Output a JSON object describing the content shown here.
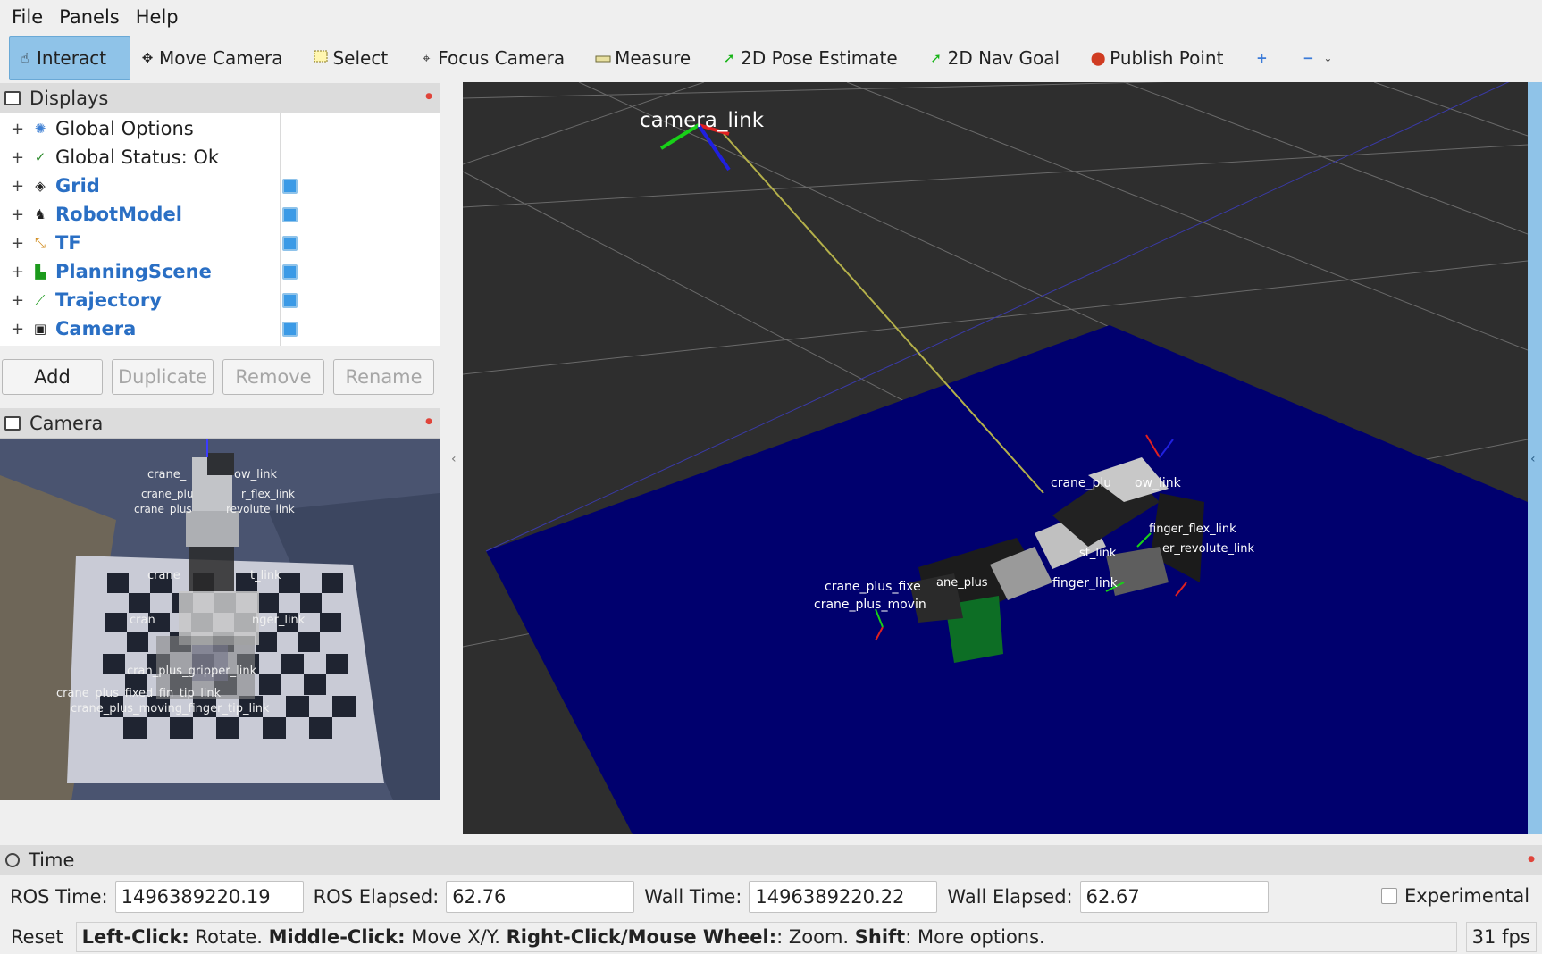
{
  "menu": {
    "file": "File",
    "panels": "Panels",
    "help": "Help"
  },
  "toolbar": {
    "interact": "Interact",
    "move_camera": "Move Camera",
    "select": "Select",
    "focus_camera": "Focus Camera",
    "measure": "Measure",
    "pose_estimate": "2D Pose Estimate",
    "nav_goal": "2D Nav Goal",
    "publish_point": "Publish Point"
  },
  "displays": {
    "title": "Displays",
    "items": [
      {
        "label": "Global Options",
        "icon": "gear-icon",
        "checked": false
      },
      {
        "label": "Global Status: Ok",
        "icon": "check-icon",
        "checked": false
      },
      {
        "label": "Grid",
        "icon": "grid-icon",
        "checked": true
      },
      {
        "label": "RobotModel",
        "icon": "robot-icon",
        "checked": true
      },
      {
        "label": "TF",
        "icon": "tf-axes-icon",
        "checked": true
      },
      {
        "label": "PlanningScene",
        "icon": "planning-scene-icon",
        "checked": true
      },
      {
        "label": "Trajectory",
        "icon": "trajectory-icon",
        "checked": true
      },
      {
        "label": "Camera",
        "icon": "camera-icon",
        "checked": true
      }
    ],
    "buttons": {
      "add": "Add",
      "duplicate": "Duplicate",
      "remove": "Remove",
      "rename": "Rename"
    }
  },
  "camera_panel": {
    "title": "Camera",
    "labels": {
      "l1": "crane_",
      "l1b": "ow_link",
      "l2": "crane_plu",
      "l2b": "r_flex_link",
      "l3": "crane_plus",
      "l3b": "revolute_link",
      "l4": "crane",
      "l4b": "t_link",
      "l5": "cran",
      "l5b": "nger_link",
      "l6": "cran_plus_gripper_link",
      "l7": "crane_plus_fixed_fin_tip_link",
      "l8": "crane_plus_moving_finger_tip_link"
    }
  },
  "view3d": {
    "frame_label": "camera_link",
    "labels": {
      "a": "crane_plu",
      "ab": "ow_link",
      "b": "finger_flex_link",
      "c": "er_revolute_link",
      "d": "st_link",
      "e": "crane_plus_fixe",
      "f": "ane_plus",
      "g": "crane_plus_movin",
      "h": "finger_link"
    }
  },
  "time_panel": {
    "title": "Time",
    "ros_time_label": "ROS Time:",
    "ros_time": "1496389220.19",
    "ros_elapsed_label": "ROS Elapsed:",
    "ros_elapsed": "62.76",
    "wall_time_label": "Wall Time:",
    "wall_time": "1496389220.22",
    "wall_elapsed_label": "Wall Elapsed:",
    "wall_elapsed": "62.67",
    "experimental_label": "Experimental"
  },
  "statusbar": {
    "reset": "Reset",
    "hint_left_key": "Left-Click:",
    "hint_left": " Rotate. ",
    "hint_middle_key": "Middle-Click:",
    "hint_middle": " Move X/Y. ",
    "hint_right_key": "Right-Click/Mouse Wheel:",
    "hint_right": ": Zoom. ",
    "hint_shift_key": "Shift",
    "hint_shift": ": More options.",
    "fps": "31 fps"
  },
  "colors": {
    "accent": "#8fc3e8",
    "link_text": "#2a6fc4",
    "ground_plane": "#00006e",
    "viewport_bg": "#2e2e2e"
  }
}
